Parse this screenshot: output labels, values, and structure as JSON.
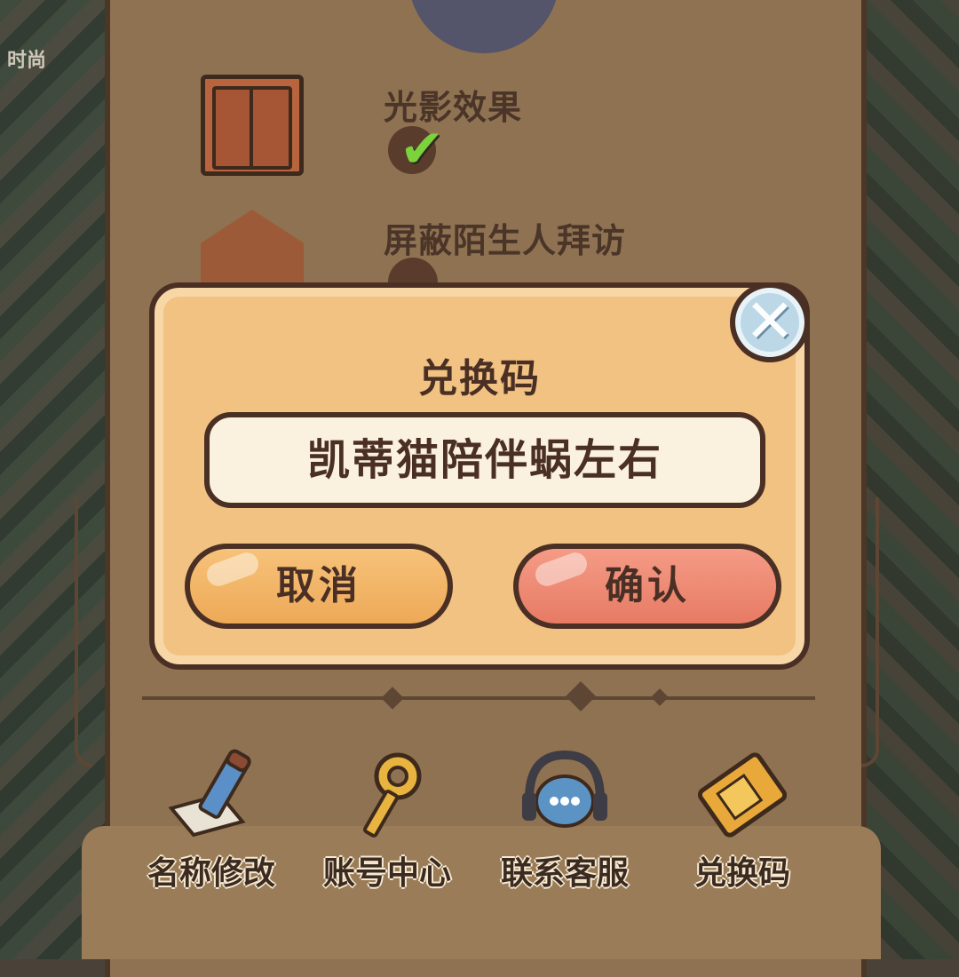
{
  "background": {
    "left_label": "时尚"
  },
  "settings": {
    "items": [
      {
        "label": "光影效果",
        "icon": "window-icon",
        "enabled": true
      },
      {
        "label": "屏蔽陌生人拜访",
        "icon": "house-block-icon",
        "enabled": false
      }
    ]
  },
  "actions": [
    {
      "label": "名称修改",
      "icon": "pencil-icon"
    },
    {
      "label": "账号中心",
      "icon": "key-icon"
    },
    {
      "label": "联系客服",
      "icon": "headset-chat-icon"
    },
    {
      "label": "兑换码",
      "icon": "ticket-icon"
    }
  ],
  "modal": {
    "title": "兑换码",
    "input_value": "凯蒂猫陪伴蜗左右",
    "cancel_label": "取消",
    "confirm_label": "确认"
  },
  "colors": {
    "modal_bg": "#f2c283",
    "cancel_button": "#eda957",
    "confirm_button": "#e77b64",
    "close_button": "#bcd8e6",
    "check_green": "#7bd23a"
  }
}
